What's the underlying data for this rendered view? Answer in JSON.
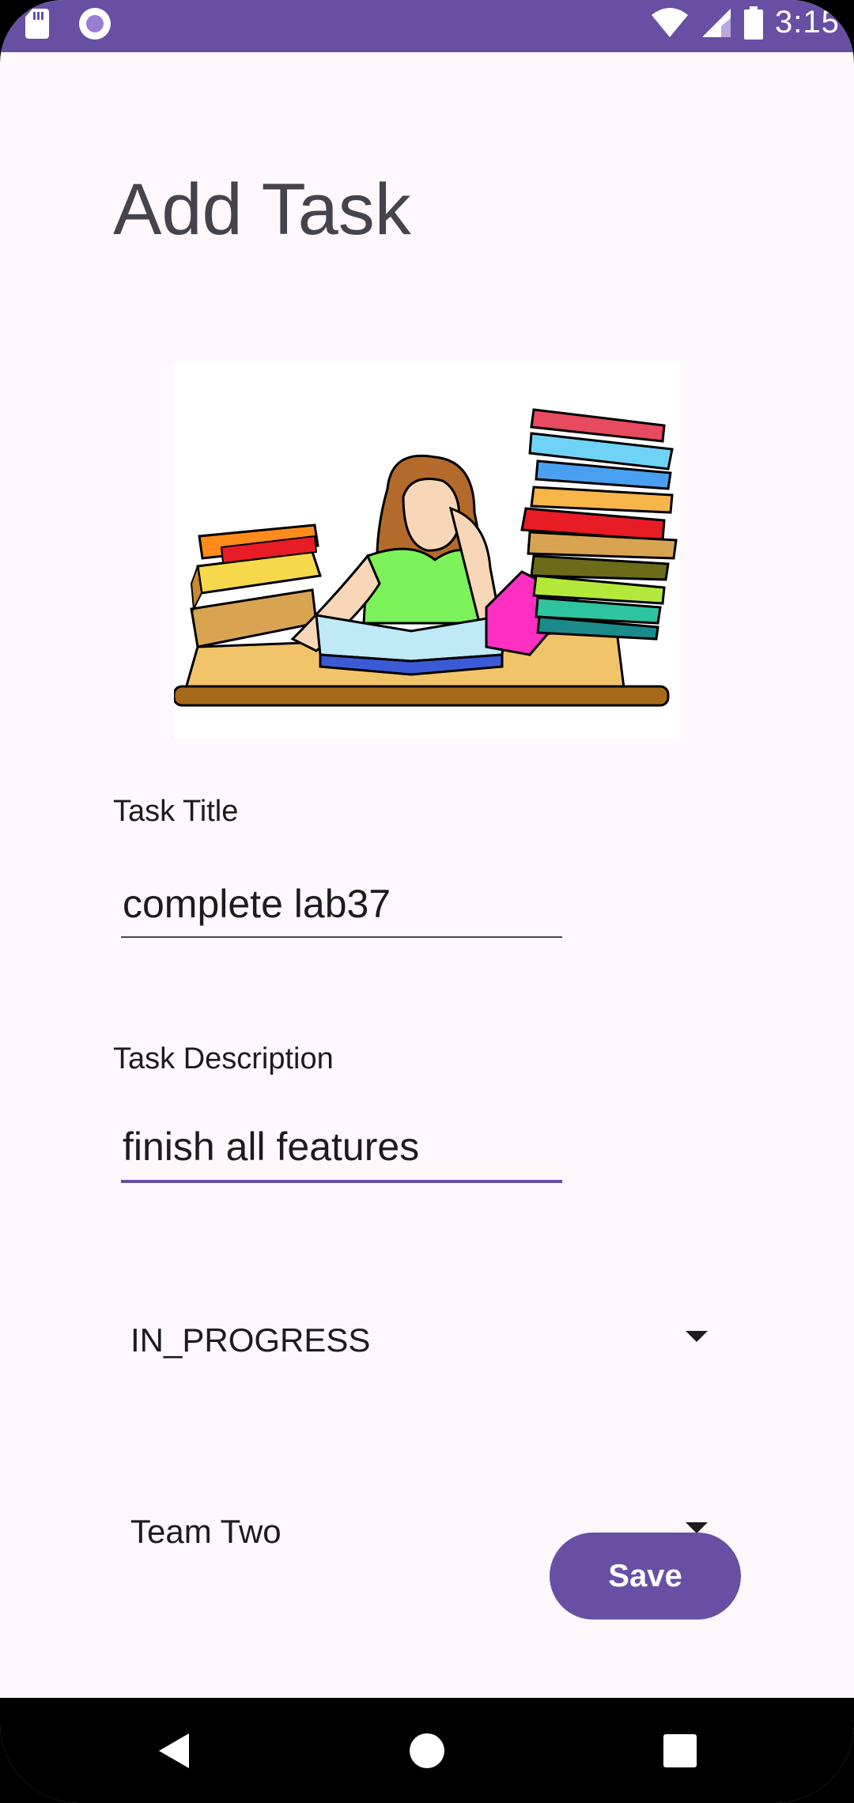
{
  "status_bar": {
    "time": "3:15",
    "icons": [
      "sd-card-icon",
      "circle-notification-icon",
      "wifi-icon",
      "signal-icon",
      "battery-icon"
    ]
  },
  "page": {
    "title": "Add Task"
  },
  "illustration": {
    "icon": "studying-girl-with-books-illustration"
  },
  "task_title": {
    "label": "Task Title",
    "value": "complete lab37"
  },
  "task_description": {
    "label": "Task Description",
    "value": "finish all features"
  },
  "status_spinner": {
    "selected": "IN_PROGRESS"
  },
  "team_spinner": {
    "selected": "Team Two"
  },
  "save_button": {
    "label": "Save"
  },
  "colors": {
    "primary": "#6750a4",
    "background": "#fef7fc",
    "text": "#1d1b20"
  }
}
